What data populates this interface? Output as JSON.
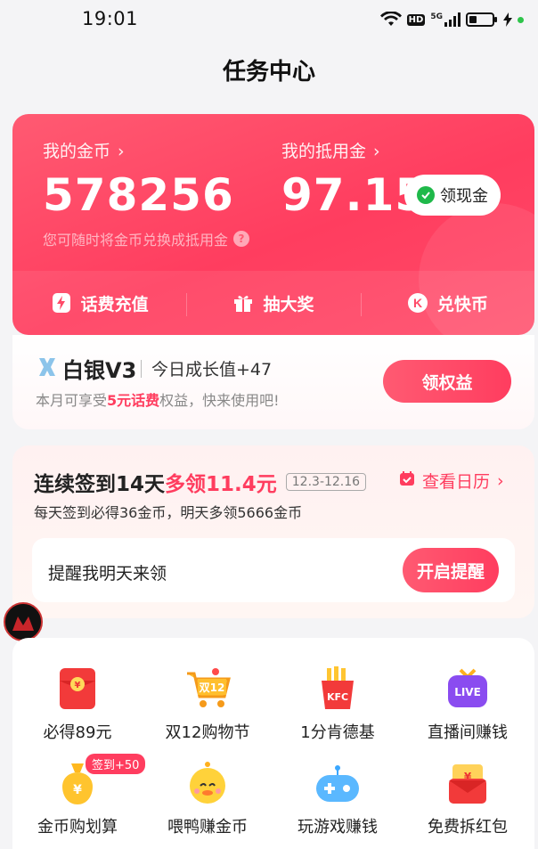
{
  "status_bar": {
    "time": "19:01",
    "network": "5G",
    "hd": "HD"
  },
  "header": {
    "title": "任务中心"
  },
  "wallet": {
    "coins_label": "我的金币",
    "coins_value": "578256",
    "voucher_label": "我的抵用金",
    "voucher_value": "97.15",
    "claim_cash_label": "领现金",
    "tip": "您可随时将金币兑换成抵用金",
    "actions": [
      {
        "label": "话费充值",
        "icon": "lightning-icon"
      },
      {
        "label": "抽大奖",
        "icon": "gift-icon"
      },
      {
        "label": "兑快币",
        "icon": "k-coin-icon"
      }
    ]
  },
  "member": {
    "level": "白银V3",
    "growth": "今日成长值+47",
    "desc_prefix": "本月可享受",
    "desc_highlight": "5元话费",
    "desc_suffix": "权益，快来使用吧!",
    "button": "领权益"
  },
  "signin": {
    "title_main": "连续签到14天",
    "title_red": "多领11.4元",
    "date_range": "12.3-12.16",
    "calendar_link": "查看日历",
    "subtitle": "每天签到必得36金币，明天多领5666金币",
    "remind_text": "提醒我明天来领",
    "remind_button": "开启提醒"
  },
  "grid": [
    {
      "label": "必得89元",
      "icon": "red-envelope-icon"
    },
    {
      "label": "双12购物节",
      "icon": "shopping-cart-icon"
    },
    {
      "label": "1分肯德基",
      "icon": "kfc-fries-icon"
    },
    {
      "label": "直播间赚钱",
      "icon": "live-tv-icon"
    },
    {
      "label": "金币购划算",
      "icon": "money-bag-icon",
      "badge": "签到+50"
    },
    {
      "label": "喂鸭赚金币",
      "icon": "duck-icon"
    },
    {
      "label": "玩游戏赚钱",
      "icon": "gamepad-icon"
    },
    {
      "label": "免费拆红包",
      "icon": "red-packet-icon"
    }
  ],
  "colors": {
    "primary": "#ff3d5f",
    "card_gradient_start": "#ff5a72",
    "cash_green": "#1fb94a"
  }
}
